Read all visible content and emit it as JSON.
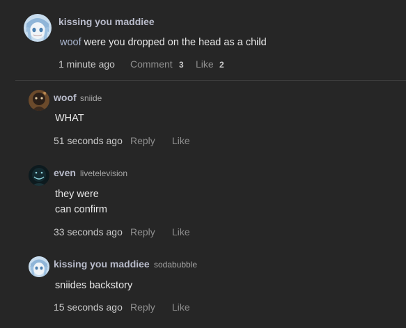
{
  "parent_comment": {
    "author": "kissing you maddiee",
    "mention": "woof",
    "text": " were you dropped on the head as a child",
    "time": "1 minute ago",
    "comment_label": "Comment",
    "comment_count": "3",
    "like_label": "Like",
    "like_count": "2",
    "avatar_icon": "anime-avatar-icon"
  },
  "replies": [
    {
      "author": "woof",
      "handle": "sniide",
      "lines": [
        "WHAT"
      ],
      "time": "51 seconds ago",
      "reply_label": "Reply",
      "like_label": "Like",
      "avatar_icon": "dark-character-avatar-icon"
    },
    {
      "author": "even",
      "handle": "livetelevision",
      "lines": [
        "they were",
        "can confirm"
      ],
      "time": "33 seconds ago",
      "reply_label": "Reply",
      "like_label": "Like",
      "avatar_icon": "dark-grinning-avatar-icon"
    },
    {
      "author": "kissing you maddiee",
      "handle": "sodabubble",
      "lines": [
        "sniides backstory"
      ],
      "time": "15 seconds ago",
      "reply_label": "Reply",
      "like_label": "Like",
      "avatar_icon": "anime-avatar-icon"
    }
  ],
  "colors": {
    "background": "#262626",
    "author_name": "#b9bccb",
    "mention": "#aab6cf",
    "body_text": "#e8e8e8",
    "action_text": "#8f8f8f"
  }
}
